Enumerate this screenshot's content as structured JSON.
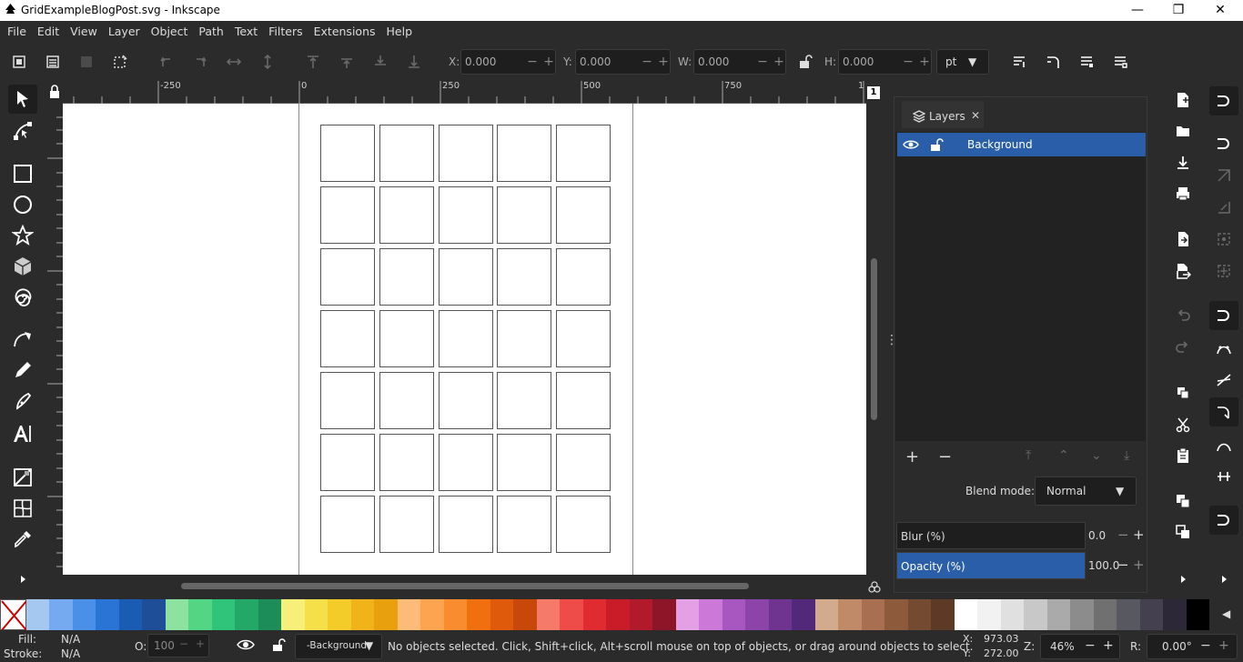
{
  "window": {
    "title": "GridExampleBlogPost.svg - Inkscape",
    "controls": [
      "—",
      "❐",
      "✕"
    ]
  },
  "menu": [
    "File",
    "Edit",
    "View",
    "Layer",
    "Object",
    "Path",
    "Text",
    "Filters",
    "Extensions",
    "Help"
  ],
  "toolbar": {
    "x_label": "X:",
    "x_value": "0.000",
    "y_label": "Y:",
    "y_value": "0.000",
    "w_label": "W:",
    "w_value": "0.000",
    "h_label": "H:",
    "h_value": "0.000",
    "unit": "pt"
  },
  "ruler": {
    "top_ticks": [
      "-250",
      "0",
      "250",
      "500",
      "750",
      "1"
    ],
    "corner_badge": "1"
  },
  "grid": {
    "rows": 7,
    "cols": 5
  },
  "layers_panel": {
    "tab_label": "Layers",
    "layer_name": "Background",
    "blend_label": "Blend mode:",
    "blend_value": "Normal",
    "blur_label": "Blur (%)",
    "blur_value": "0.0",
    "opacity_label": "Opacity (%)",
    "opacity_value": "100.0"
  },
  "palette_colors": [
    "#a4c8f0",
    "#76aaf0",
    "#4a90e8",
    "#2a74d6",
    "#1a5cb4",
    "#1e4e98",
    "#8ee2a0",
    "#52d684",
    "#30c47a",
    "#24a868",
    "#1c8c58",
    "#f6f07a",
    "#f6e04a",
    "#f4cc2a",
    "#f0b41a",
    "#e8a00e",
    "#fcbc78",
    "#fca450",
    "#f88c2e",
    "#f07010",
    "#e05a0c",
    "#c8480a",
    "#f67a6a",
    "#ee4c48",
    "#e02c30",
    "#c81c28",
    "#b01a2a",
    "#8c1628",
    "#e4a0e4",
    "#cc78d8",
    "#a856c0",
    "#8c44a8",
    "#6e3490",
    "#52287a",
    "#d2aa8e",
    "#c08a68",
    "#a87050",
    "#8e5a3c",
    "#744a30",
    "#5c3a26",
    "#ffffff",
    "#f2f2f2",
    "#e0e0e0",
    "#c8c8c8",
    "#aaaaaa",
    "#8c8c8c",
    "#707070",
    "#585860",
    "#444050",
    "#2c2838",
    "#000000"
  ],
  "status": {
    "fill_label": "Fill:",
    "fill_value": "N/A",
    "stroke_label": "Stroke:",
    "stroke_value": "N/A",
    "opacity_label": "O:",
    "opacity_value": "100",
    "layer_select": "-Background",
    "message": "No objects selected. Click, Shift+click, Alt+scroll mouse on top of objects, or drag around objects to select.",
    "x_label": "X:",
    "x_value": "973.03",
    "y_label": "Y:",
    "y_value": "272.00",
    "zoom_label": "Z:",
    "zoom_value": "46%",
    "rot_label": "R:",
    "rot_value": "0.00°"
  }
}
